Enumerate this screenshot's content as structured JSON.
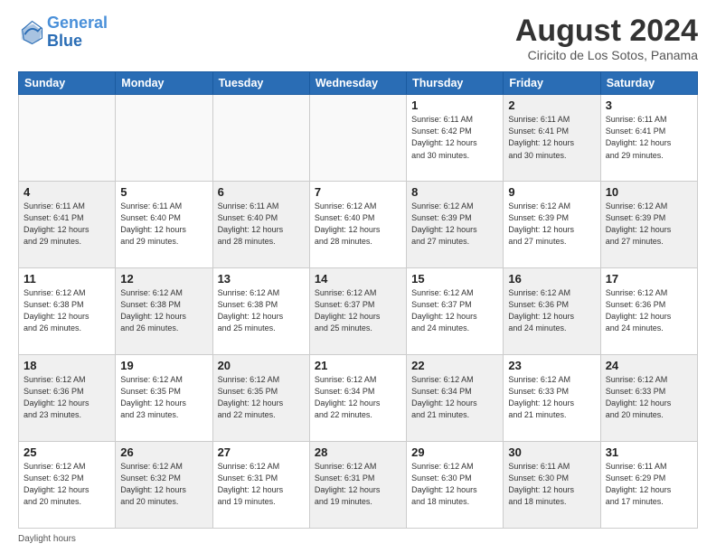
{
  "header": {
    "logo_general": "General",
    "logo_blue": "Blue",
    "main_title": "August 2024",
    "sub_title": "Ciricito de Los Sotos, Panama"
  },
  "footer": {
    "daylight_label": "Daylight hours"
  },
  "weekdays": [
    "Sunday",
    "Monday",
    "Tuesday",
    "Wednesday",
    "Thursday",
    "Friday",
    "Saturday"
  ],
  "weeks": [
    [
      {
        "day": "",
        "info": "",
        "empty": true
      },
      {
        "day": "",
        "info": "",
        "empty": true
      },
      {
        "day": "",
        "info": "",
        "empty": true
      },
      {
        "day": "",
        "info": "",
        "empty": true
      },
      {
        "day": "1",
        "info": "Sunrise: 6:11 AM\nSunset: 6:42 PM\nDaylight: 12 hours\nand 30 minutes."
      },
      {
        "day": "2",
        "info": "Sunrise: 6:11 AM\nSunset: 6:41 PM\nDaylight: 12 hours\nand 30 minutes."
      },
      {
        "day": "3",
        "info": "Sunrise: 6:11 AM\nSunset: 6:41 PM\nDaylight: 12 hours\nand 29 minutes."
      }
    ],
    [
      {
        "day": "4",
        "info": "Sunrise: 6:11 AM\nSunset: 6:41 PM\nDaylight: 12 hours\nand 29 minutes."
      },
      {
        "day": "5",
        "info": "Sunrise: 6:11 AM\nSunset: 6:40 PM\nDaylight: 12 hours\nand 29 minutes."
      },
      {
        "day": "6",
        "info": "Sunrise: 6:11 AM\nSunset: 6:40 PM\nDaylight: 12 hours\nand 28 minutes."
      },
      {
        "day": "7",
        "info": "Sunrise: 6:12 AM\nSunset: 6:40 PM\nDaylight: 12 hours\nand 28 minutes."
      },
      {
        "day": "8",
        "info": "Sunrise: 6:12 AM\nSunset: 6:39 PM\nDaylight: 12 hours\nand 27 minutes."
      },
      {
        "day": "9",
        "info": "Sunrise: 6:12 AM\nSunset: 6:39 PM\nDaylight: 12 hours\nand 27 minutes."
      },
      {
        "day": "10",
        "info": "Sunrise: 6:12 AM\nSunset: 6:39 PM\nDaylight: 12 hours\nand 27 minutes."
      }
    ],
    [
      {
        "day": "11",
        "info": "Sunrise: 6:12 AM\nSunset: 6:38 PM\nDaylight: 12 hours\nand 26 minutes."
      },
      {
        "day": "12",
        "info": "Sunrise: 6:12 AM\nSunset: 6:38 PM\nDaylight: 12 hours\nand 26 minutes."
      },
      {
        "day": "13",
        "info": "Sunrise: 6:12 AM\nSunset: 6:38 PM\nDaylight: 12 hours\nand 25 minutes."
      },
      {
        "day": "14",
        "info": "Sunrise: 6:12 AM\nSunset: 6:37 PM\nDaylight: 12 hours\nand 25 minutes."
      },
      {
        "day": "15",
        "info": "Sunrise: 6:12 AM\nSunset: 6:37 PM\nDaylight: 12 hours\nand 24 minutes."
      },
      {
        "day": "16",
        "info": "Sunrise: 6:12 AM\nSunset: 6:36 PM\nDaylight: 12 hours\nand 24 minutes."
      },
      {
        "day": "17",
        "info": "Sunrise: 6:12 AM\nSunset: 6:36 PM\nDaylight: 12 hours\nand 24 minutes."
      }
    ],
    [
      {
        "day": "18",
        "info": "Sunrise: 6:12 AM\nSunset: 6:36 PM\nDaylight: 12 hours\nand 23 minutes."
      },
      {
        "day": "19",
        "info": "Sunrise: 6:12 AM\nSunset: 6:35 PM\nDaylight: 12 hours\nand 23 minutes."
      },
      {
        "day": "20",
        "info": "Sunrise: 6:12 AM\nSunset: 6:35 PM\nDaylight: 12 hours\nand 22 minutes."
      },
      {
        "day": "21",
        "info": "Sunrise: 6:12 AM\nSunset: 6:34 PM\nDaylight: 12 hours\nand 22 minutes."
      },
      {
        "day": "22",
        "info": "Sunrise: 6:12 AM\nSunset: 6:34 PM\nDaylight: 12 hours\nand 21 minutes."
      },
      {
        "day": "23",
        "info": "Sunrise: 6:12 AM\nSunset: 6:33 PM\nDaylight: 12 hours\nand 21 minutes."
      },
      {
        "day": "24",
        "info": "Sunrise: 6:12 AM\nSunset: 6:33 PM\nDaylight: 12 hours\nand 20 minutes."
      }
    ],
    [
      {
        "day": "25",
        "info": "Sunrise: 6:12 AM\nSunset: 6:32 PM\nDaylight: 12 hours\nand 20 minutes."
      },
      {
        "day": "26",
        "info": "Sunrise: 6:12 AM\nSunset: 6:32 PM\nDaylight: 12 hours\nand 20 minutes."
      },
      {
        "day": "27",
        "info": "Sunrise: 6:12 AM\nSunset: 6:31 PM\nDaylight: 12 hours\nand 19 minutes."
      },
      {
        "day": "28",
        "info": "Sunrise: 6:12 AM\nSunset: 6:31 PM\nDaylight: 12 hours\nand 19 minutes."
      },
      {
        "day": "29",
        "info": "Sunrise: 6:12 AM\nSunset: 6:30 PM\nDaylight: 12 hours\nand 18 minutes."
      },
      {
        "day": "30",
        "info": "Sunrise: 6:11 AM\nSunset: 6:30 PM\nDaylight: 12 hours\nand 18 minutes."
      },
      {
        "day": "31",
        "info": "Sunrise: 6:11 AM\nSunset: 6:29 PM\nDaylight: 12 hours\nand 17 minutes."
      }
    ]
  ]
}
